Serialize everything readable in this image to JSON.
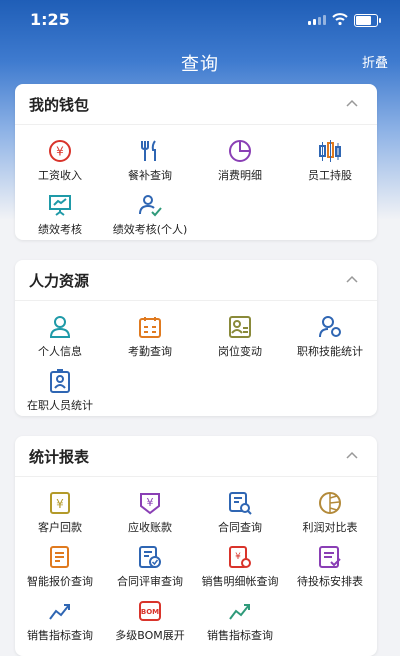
{
  "status": {
    "time": "1:25"
  },
  "nav": {
    "title": "查询",
    "collapse_label": "折叠"
  },
  "wallet": {
    "title": "我的钱包",
    "items": [
      {
        "label": "工资收入",
        "icon": "salary-yen-icon",
        "color": "#d9342b"
      },
      {
        "label": "餐补查询",
        "icon": "meal-utensils-icon",
        "color": "#2f66b3"
      },
      {
        "label": "消费明细",
        "icon": "pie-chart-icon",
        "color": "#8a3fb5"
      },
      {
        "label": "员工持股",
        "icon": "shareholding-bars-icon",
        "color": "#e07a1f"
      },
      {
        "label": "绩效考核",
        "icon": "presentation-board-icon",
        "color": "#1f9aa8"
      },
      {
        "label": "绩效考核(个人)",
        "icon": "personal-performance-icon",
        "color": "#2f9a7a"
      }
    ]
  },
  "hr": {
    "title": "人力资源",
    "items": [
      {
        "label": "个人信息",
        "icon": "user-info-icon",
        "color": "#1f9aa8"
      },
      {
        "label": "考勤查询",
        "icon": "attendance-calendar-icon",
        "color": "#e07a1f"
      },
      {
        "label": "岗位变动",
        "icon": "position-change-icon",
        "color": "#8a8a3a"
      },
      {
        "label": "职称技能统计",
        "icon": "skill-badge-icon",
        "color": "#2f66b3"
      },
      {
        "label": "在职人员统计",
        "icon": "staff-badge-icon",
        "color": "#2f66b3"
      }
    ]
  },
  "reports": {
    "title": "统计报表",
    "items": [
      {
        "label": "客户回款",
        "icon": "customer-payment-icon",
        "color": "#b39a2a"
      },
      {
        "label": "应收账款",
        "icon": "receivable-yen-icon",
        "color": "#8a3fb5"
      },
      {
        "label": "合同查询",
        "icon": "contract-search-icon",
        "color": "#2f66b3"
      },
      {
        "label": "利润对比表",
        "icon": "profit-compare-icon",
        "color": "#b38a3a"
      },
      {
        "label": "智能报价查询",
        "icon": "smart-quote-icon",
        "color": "#e07a1f"
      },
      {
        "label": "合同评审查询",
        "icon": "contract-review-icon",
        "color": "#2f66b3"
      },
      {
        "label": "销售明细帐查询",
        "icon": "sales-ledger-icon",
        "color": "#d9342b"
      },
      {
        "label": "待投标安排表",
        "icon": "bid-schedule-icon",
        "color": "#8a3fb5"
      },
      {
        "label": "销售指标查询",
        "icon": "sales-target-icon",
        "color": "#2f66b3"
      },
      {
        "label": "多级BOM展开",
        "icon": "bom-expand-icon",
        "color": "#d9342b"
      },
      {
        "label": "销售指标查询",
        "icon": "sales-target-icon-2",
        "color": "#2f9a7a"
      }
    ]
  }
}
